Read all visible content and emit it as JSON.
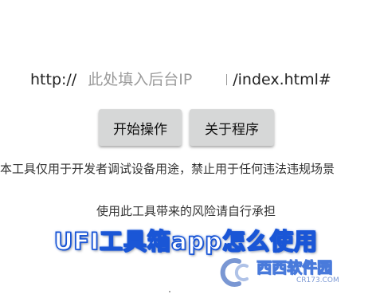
{
  "url_bar": {
    "prefix": "http://",
    "placeholder": "此处填入后台IP",
    "suffix": "/index.html#"
  },
  "buttons": {
    "start_label": "开始操作",
    "about_label": "关于程序"
  },
  "disclaimer": "本工具仅用于开发者调试设备用途，禁止用于任何违法违规场景",
  "risk_notice": "使用此工具带来的风险请自行承担",
  "banner_title": "UFI工具箱app怎么使用",
  "watermark": {
    "logo_icon": "cc-logo-icon",
    "site_name": "西西软件园",
    "site_url": "CR173.COM"
  },
  "colors": {
    "button_bg": "#d6d7d7",
    "banner_outline": "#1a56d6",
    "placeholder": "#9a9a9a"
  }
}
